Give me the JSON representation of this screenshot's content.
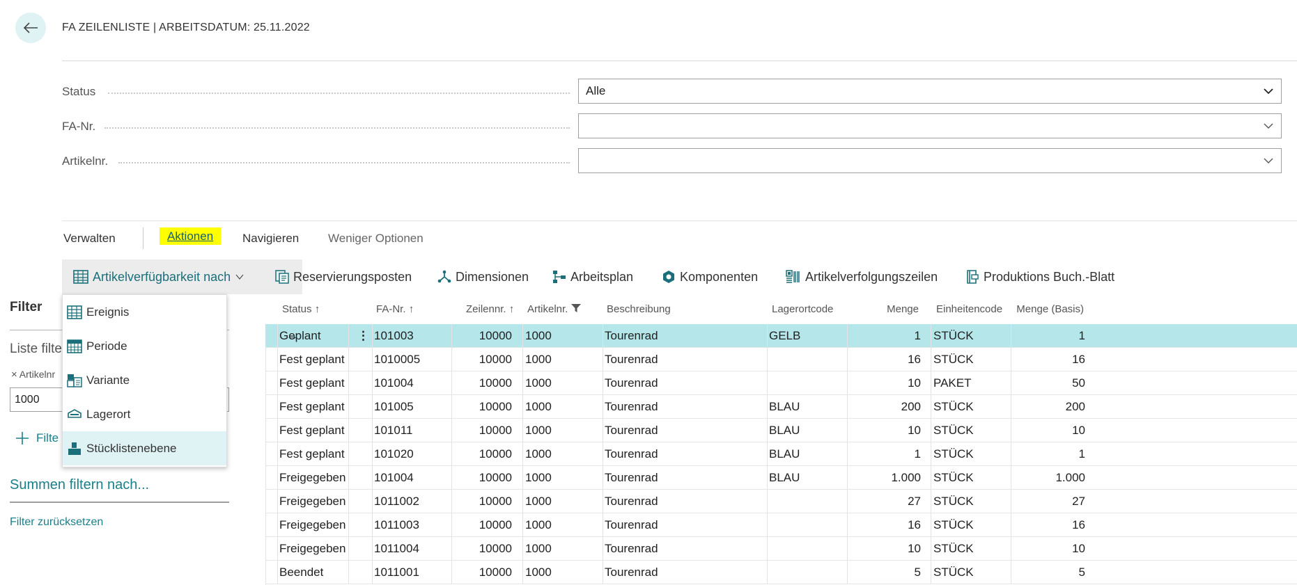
{
  "header": {
    "title": "FA ZEILENLISTE | ARBEITSDATUM: 25.11.2022"
  },
  "fields": [
    {
      "label": "Status",
      "value": "Alle"
    },
    {
      "label": "FA-Nr.",
      "value": ""
    },
    {
      "label": "Artikelnr.",
      "value": ""
    }
  ],
  "tabs": [
    "Verwalten",
    "Aktionen",
    "Navigieren",
    "Weniger Optionen"
  ],
  "actions": [
    {
      "label": "Artikelverfügbarkeit nach",
      "icon": "grid-icon"
    },
    {
      "label": "Reservierungsposten",
      "icon": "reservation-icon"
    },
    {
      "label": "Dimensionen",
      "icon": "dimensions-icon"
    },
    {
      "label": "Arbeitsplan",
      "icon": "routing-icon"
    },
    {
      "label": "Komponenten",
      "icon": "components-icon"
    },
    {
      "label": "Artikelverfolgungszeilen",
      "icon": "item-tracking-icon"
    },
    {
      "label": "Produktions Buch.-Blatt",
      "icon": "journal-icon"
    }
  ],
  "menu": [
    {
      "label": "Ereignis",
      "icon": "event-grid-icon"
    },
    {
      "label": "Periode",
      "icon": "period-calendar-icon"
    },
    {
      "label": "Variante",
      "icon": "variant-icon"
    },
    {
      "label": "Lagerort",
      "icon": "location-icon"
    },
    {
      "label": "Stücklistenebene",
      "icon": "bom-level-icon"
    }
  ],
  "filter": {
    "title": "Filter",
    "list_filter": "Liste filte",
    "chip": "Artikelnr",
    "value": "1000",
    "add_label": "Filte",
    "sums": "Summen filtern nach...",
    "reset": "Filter zurücksetzen"
  },
  "columns": [
    "Status",
    "FA-Nr.",
    "Zeilennr.",
    "Artikelnr.",
    "Beschreibung",
    "Lagerortcode",
    "Menge",
    "Einheitencode",
    "Menge (Basis)"
  ],
  "rows": [
    [
      "Geplant",
      "101003",
      "10000",
      "1000",
      "Tourenrad",
      "GELB",
      "1",
      "STÜCK",
      "1"
    ],
    [
      "Fest geplant",
      "1010005",
      "10000",
      "1000",
      "Tourenrad",
      "",
      "16",
      "STÜCK",
      "16"
    ],
    [
      "Fest geplant",
      "101004",
      "10000",
      "1000",
      "Tourenrad",
      "",
      "10",
      "PAKET",
      "50"
    ],
    [
      "Fest geplant",
      "101005",
      "10000",
      "1000",
      "Tourenrad",
      "BLAU",
      "200",
      "STÜCK",
      "200"
    ],
    [
      "Fest geplant",
      "101011",
      "10000",
      "1000",
      "Tourenrad",
      "BLAU",
      "10",
      "STÜCK",
      "10"
    ],
    [
      "Fest geplant",
      "101020",
      "10000",
      "1000",
      "Tourenrad",
      "BLAU",
      "1",
      "STÜCK",
      "1"
    ],
    [
      "Freigegeben",
      "101004",
      "10000",
      "1000",
      "Tourenrad",
      "BLAU",
      "1.000",
      "STÜCK",
      "1.000"
    ],
    [
      "Freigegeben",
      "1011002",
      "10000",
      "1000",
      "Tourenrad",
      "",
      "27",
      "STÜCK",
      "27"
    ],
    [
      "Freigegeben",
      "1011003",
      "10000",
      "1000",
      "Tourenrad",
      "",
      "16",
      "STÜCK",
      "16"
    ],
    [
      "Freigegeben",
      "1011004",
      "10000",
      "1000",
      "Tourenrad",
      "",
      "10",
      "STÜCK",
      "10"
    ],
    [
      "Beendet",
      "1011001",
      "10000",
      "1000",
      "Tourenrad",
      "",
      "5",
      "STÜCK",
      "5"
    ]
  ],
  "colors": {
    "accent": "#1a7f8a",
    "selected_row": "#b4e6ea",
    "highlight": "#ffff00",
    "menu_selected": "#dff2f4"
  }
}
